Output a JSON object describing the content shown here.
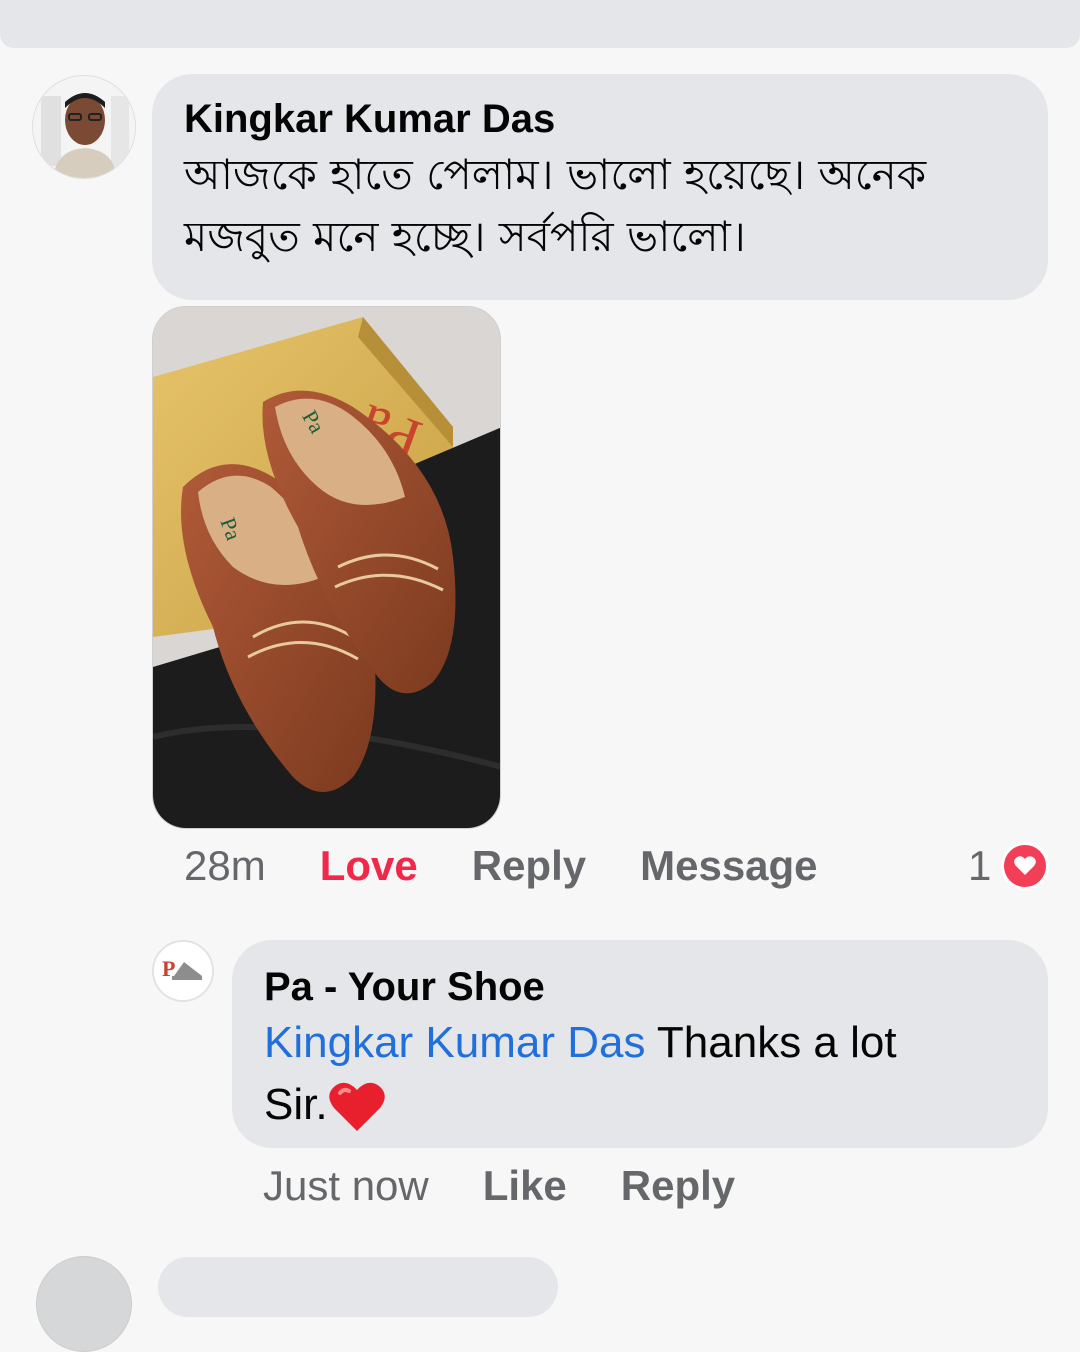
{
  "comment": {
    "author": "Kingkar Kumar Das",
    "text": "আজকে হাতে পেলাম। ভালো হয়েছে। অনেক মজবুত মনে হচ্ছে। সর্বপরি ভালো।",
    "text_line1": "আজকে হাতে পেলাম। ভালো হয়েছে। অনেক",
    "text_line2": "মজবুত মনে হচ্ছে। সর্বপরি ভালো।",
    "photo_icon": "shoe-photo",
    "time": "28m",
    "love_label": "Love",
    "reply_label": "Reply",
    "message_label": "Message",
    "reaction_count": "1",
    "reaction_icon": "heart-icon"
  },
  "reply": {
    "author": "Pa - Your Shoe",
    "mention": "Kingkar Kumar Das",
    "text": " Thanks a lot",
    "text_line2": "Sir.",
    "emoji": "❤️",
    "time": "Just now",
    "like_label": "Like",
    "reply_label": "Reply"
  },
  "colors": {
    "accent_love": "#f02849",
    "mention_blue": "#216fdb",
    "bubble_bg": "#e4e6ea",
    "muted_text": "#65676b"
  }
}
